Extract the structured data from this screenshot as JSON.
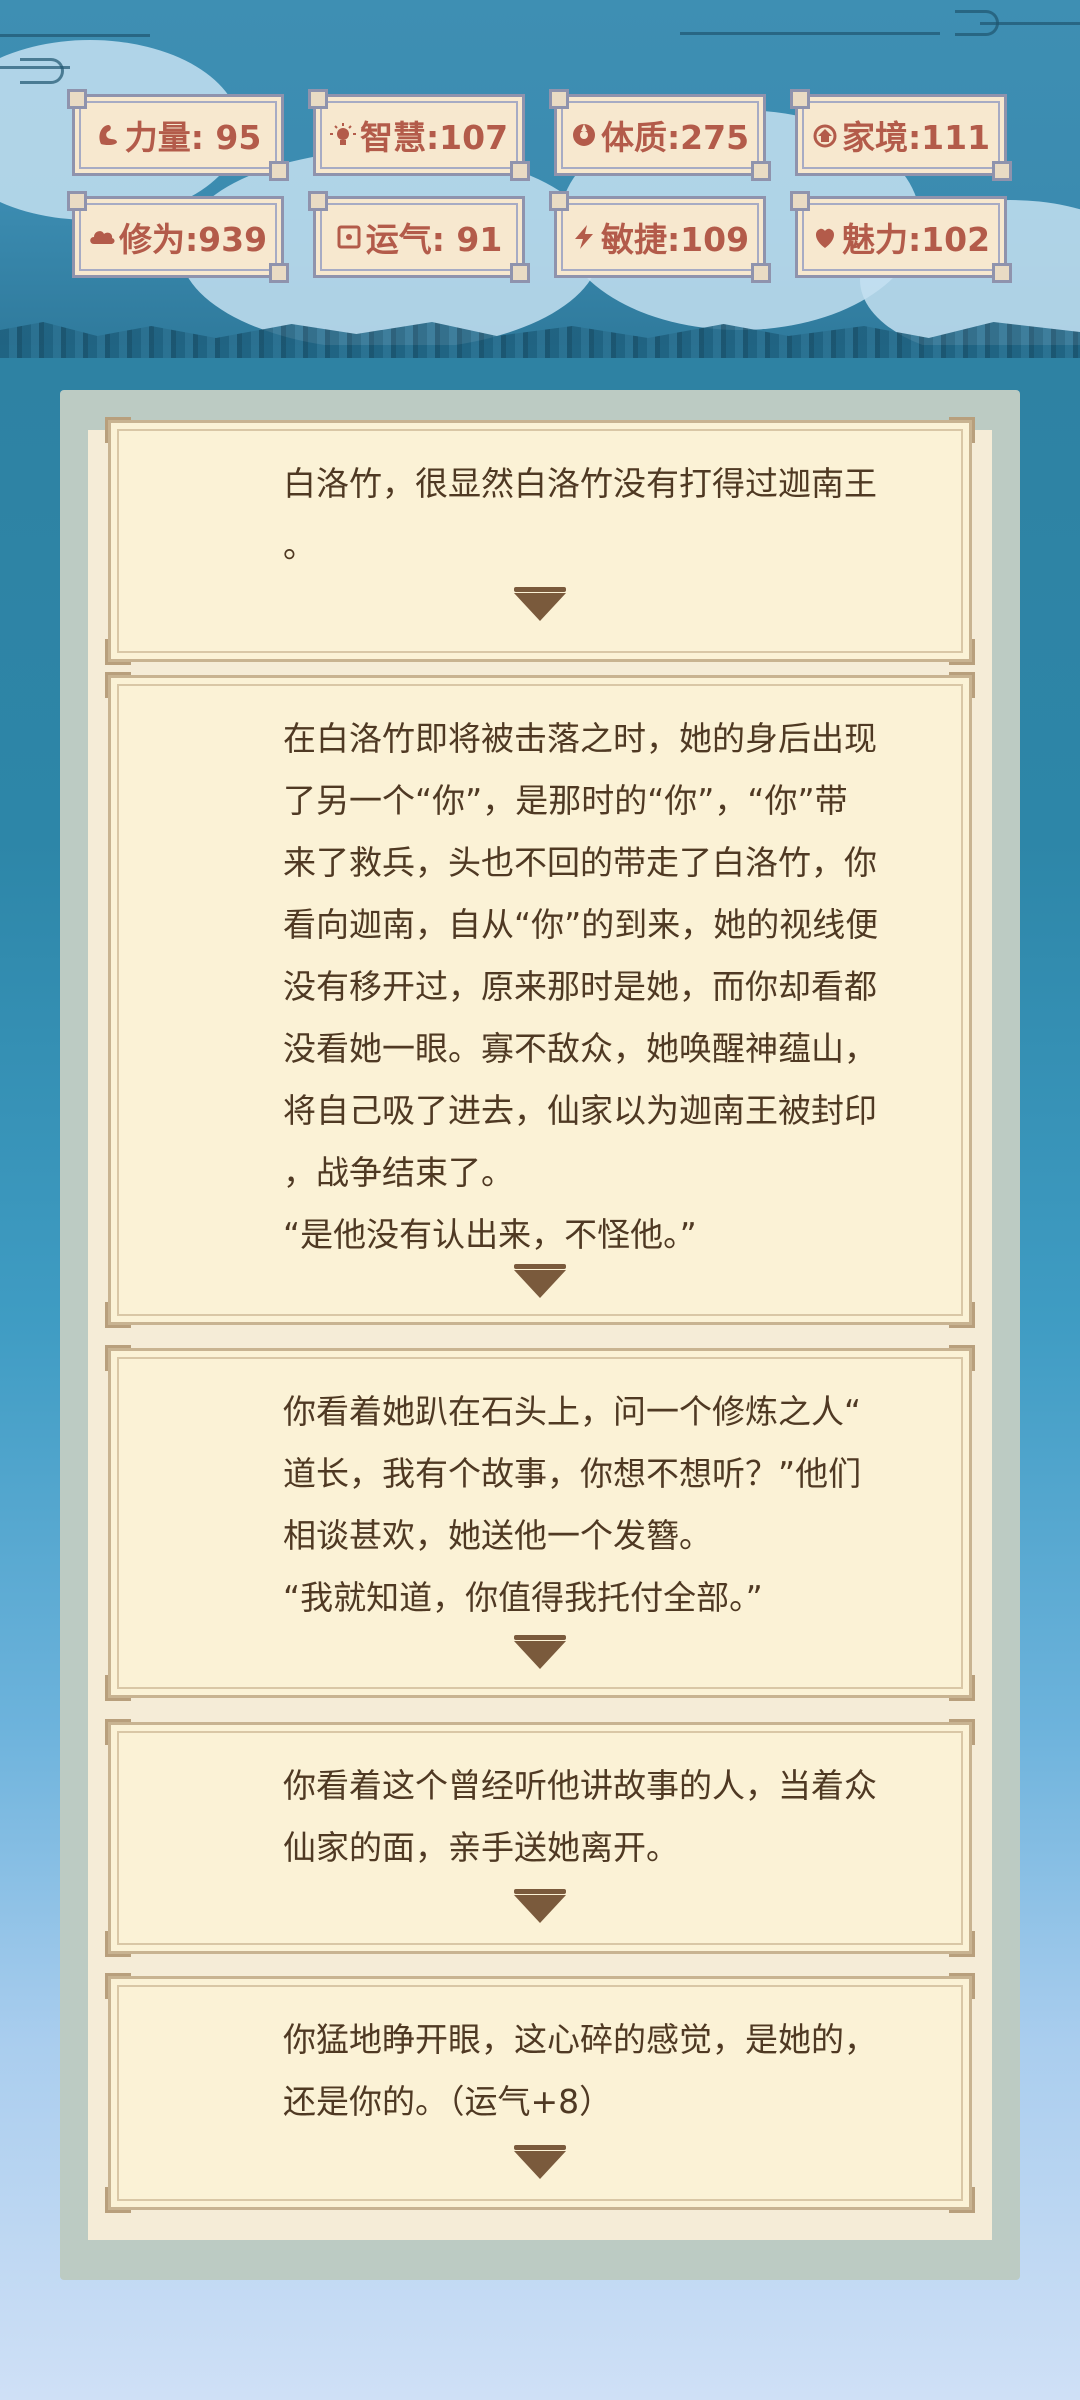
{
  "stats": [
    {
      "icon": "arm-icon",
      "label": "力量: 95",
      "color": "#b35b4a"
    },
    {
      "icon": "bulb-icon",
      "label": "智慧:107",
      "color": "#b35b4a"
    },
    {
      "icon": "body-icon",
      "label": "体质:275",
      "color": "#b35b4a"
    },
    {
      "icon": "home-icon",
      "label": "家境:111",
      "color": "#b35b4a"
    },
    {
      "icon": "cloud-icon",
      "label": "修为:939",
      "color": "#b35b4a"
    },
    {
      "icon": "luck-icon",
      "label": "运气: 91",
      "color": "#b35b4a"
    },
    {
      "icon": "lightning-icon",
      "label": "敏捷:109",
      "color": "#b35b4a"
    },
    {
      "icon": "charm-icon",
      "label": "魅力:102",
      "color": "#b35b4a"
    }
  ],
  "story": [
    {
      "text": "白洛竹，很显然白洛竹没有打得过迦南王\n。"
    },
    {
      "text": "在白洛竹即将被击落之时，她的身后出现\n了另一个“你”，是那时的“你”，“你”带\n来了救兵，头也不回的带走了白洛竹，你\n看向迦南，自从“你”的到来，她的视线便\n没有移开过，原来那时是她，而你却看都\n没看她一眼。寡不敌众，她唤醒神蕴山，\n将自己吸了进去，仙家以为迦南王被封印\n，战争结束了。\n“是他没有认出来，不怪他。”"
    },
    {
      "text": "你看着她趴在石头上，问一个修炼之人“\n道长，我有个故事，你想不想听？”他们\n相谈甚欢，她送他一个发簪。\n“我就知道，你值得我托付全部。”"
    },
    {
      "text": "你看着这个曾经听他讲故事的人，当着众\n仙家的面，亲手送她离开。"
    },
    {
      "text": "你猛地睁开眼，这心碎的感觉，是她的，\n还是你的。（运气+8）"
    }
  ]
}
